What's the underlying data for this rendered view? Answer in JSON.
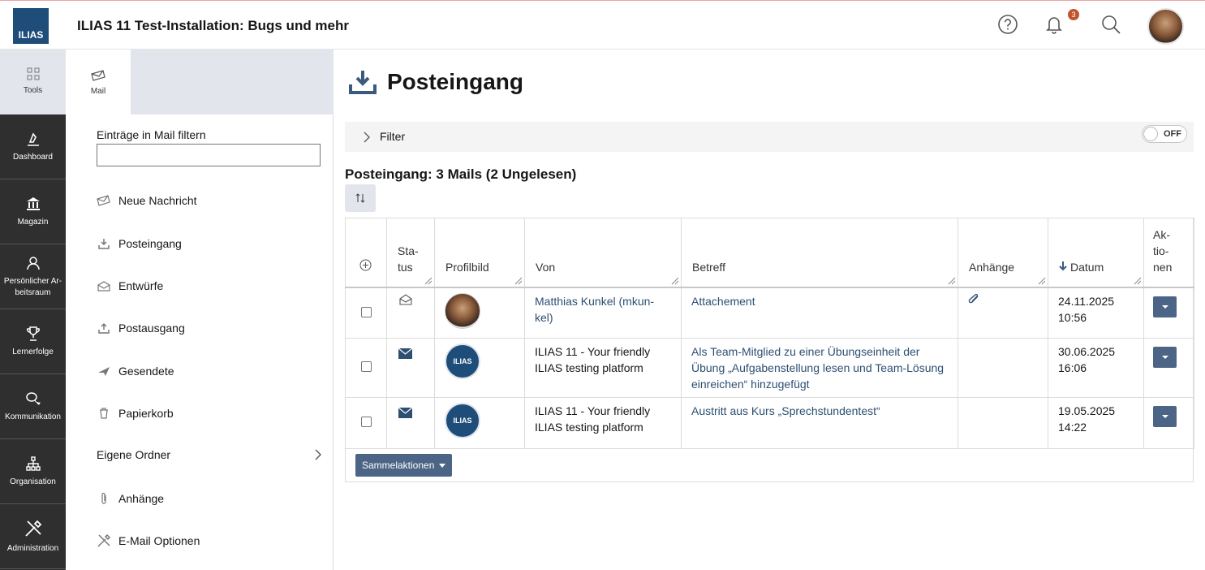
{
  "header": {
    "logo_text": "ILIAS",
    "title": "ILIAS 11 Test-Installation: Bugs und mehr",
    "notification_count": "3",
    "icons": [
      "help-icon",
      "bell-icon",
      "search-icon",
      "avatar"
    ]
  },
  "mainbar": {
    "items": [
      {
        "label": "Tools",
        "icon": "grid-icon"
      },
      {
        "label": "Dashboard",
        "icon": "dashboard-icon"
      },
      {
        "label": "Magazin",
        "icon": "library-icon"
      },
      {
        "label": "Persönlicher Ar-beitsraum",
        "icon": "person-icon"
      },
      {
        "label": "Lernerfolge",
        "icon": "trophy-icon"
      },
      {
        "label": "Kommunikation",
        "icon": "chat-icon"
      },
      {
        "label": "Organisation",
        "icon": "org-icon"
      },
      {
        "label": "Administration",
        "icon": "tools-icon"
      }
    ]
  },
  "slate": {
    "tab_label": "Mail",
    "filter_label": "Einträge in Mail filtern",
    "filter_value": "",
    "links": [
      {
        "label": "Neue Nachricht",
        "icon": "compose-icon"
      },
      {
        "label": "Posteingang",
        "icon": "inbox-icon"
      },
      {
        "label": "Entwürfe",
        "icon": "drafts-icon"
      },
      {
        "label": "Postausgang",
        "icon": "outbox-icon"
      },
      {
        "label": "Gesendete",
        "icon": "sent-icon"
      },
      {
        "label": "Papierkorb",
        "icon": "trash-icon"
      }
    ],
    "own_folders": "Eigene Ordner",
    "attachments": "Anhänge",
    "mail_options": "E-Mail Optionen"
  },
  "content": {
    "page_title": "Posteingang",
    "filter_label": "Filter",
    "filter_toggle": "OFF",
    "section_title": "Posteingang: 3 Mails (2 Ungelesen)",
    "columns": {
      "status": "Sta-tus",
      "status_l1": "Sta-",
      "status_l2": "tus",
      "picture": "Profilbild",
      "from": "Von",
      "subject": "Betreff",
      "attachments": "Anhänge",
      "date": "Datum",
      "actions_l1": "Ak-",
      "actions_l2": "tio-",
      "actions_l3": "nen"
    },
    "rows": [
      {
        "status": "read",
        "from_l1": "Matthias Kunkel (mkun-",
        "from_l2": "kel)",
        "subject": "Attachement",
        "has_attachment": true,
        "date_l1": "24.11.2025",
        "date_l2": "10:56"
      },
      {
        "status": "unread",
        "from_l1": "ILIAS 11 - Your friendly",
        "from_l2": "ILIAS testing platform",
        "subject": "Als Team-Mitglied zu einer Übungseinheit der Übung „Aufgabenstellung lesen und Team-Lösung einreichen“ hinzugefügt",
        "has_attachment": false,
        "date_l1": "30.06.2025",
        "date_l2": "16:06"
      },
      {
        "status": "unread",
        "from_l1": "ILIAS 11 - Your friendly",
        "from_l2": "ILIAS testing platform",
        "subject": "Austritt aus Kurs „Sprechstundentest“",
        "has_attachment": false,
        "date_l1": "19.05.2025",
        "date_l2": "14:22"
      }
    ],
    "bulk_actions": "Sammelaktionen",
    "ilias_badge": "ILIAS"
  },
  "colors": {
    "accent": "#4c6586",
    "link": "#2c4f72",
    "mainbar_bg": "#2f2f2f",
    "logo_bg": "#1f4d7a"
  }
}
